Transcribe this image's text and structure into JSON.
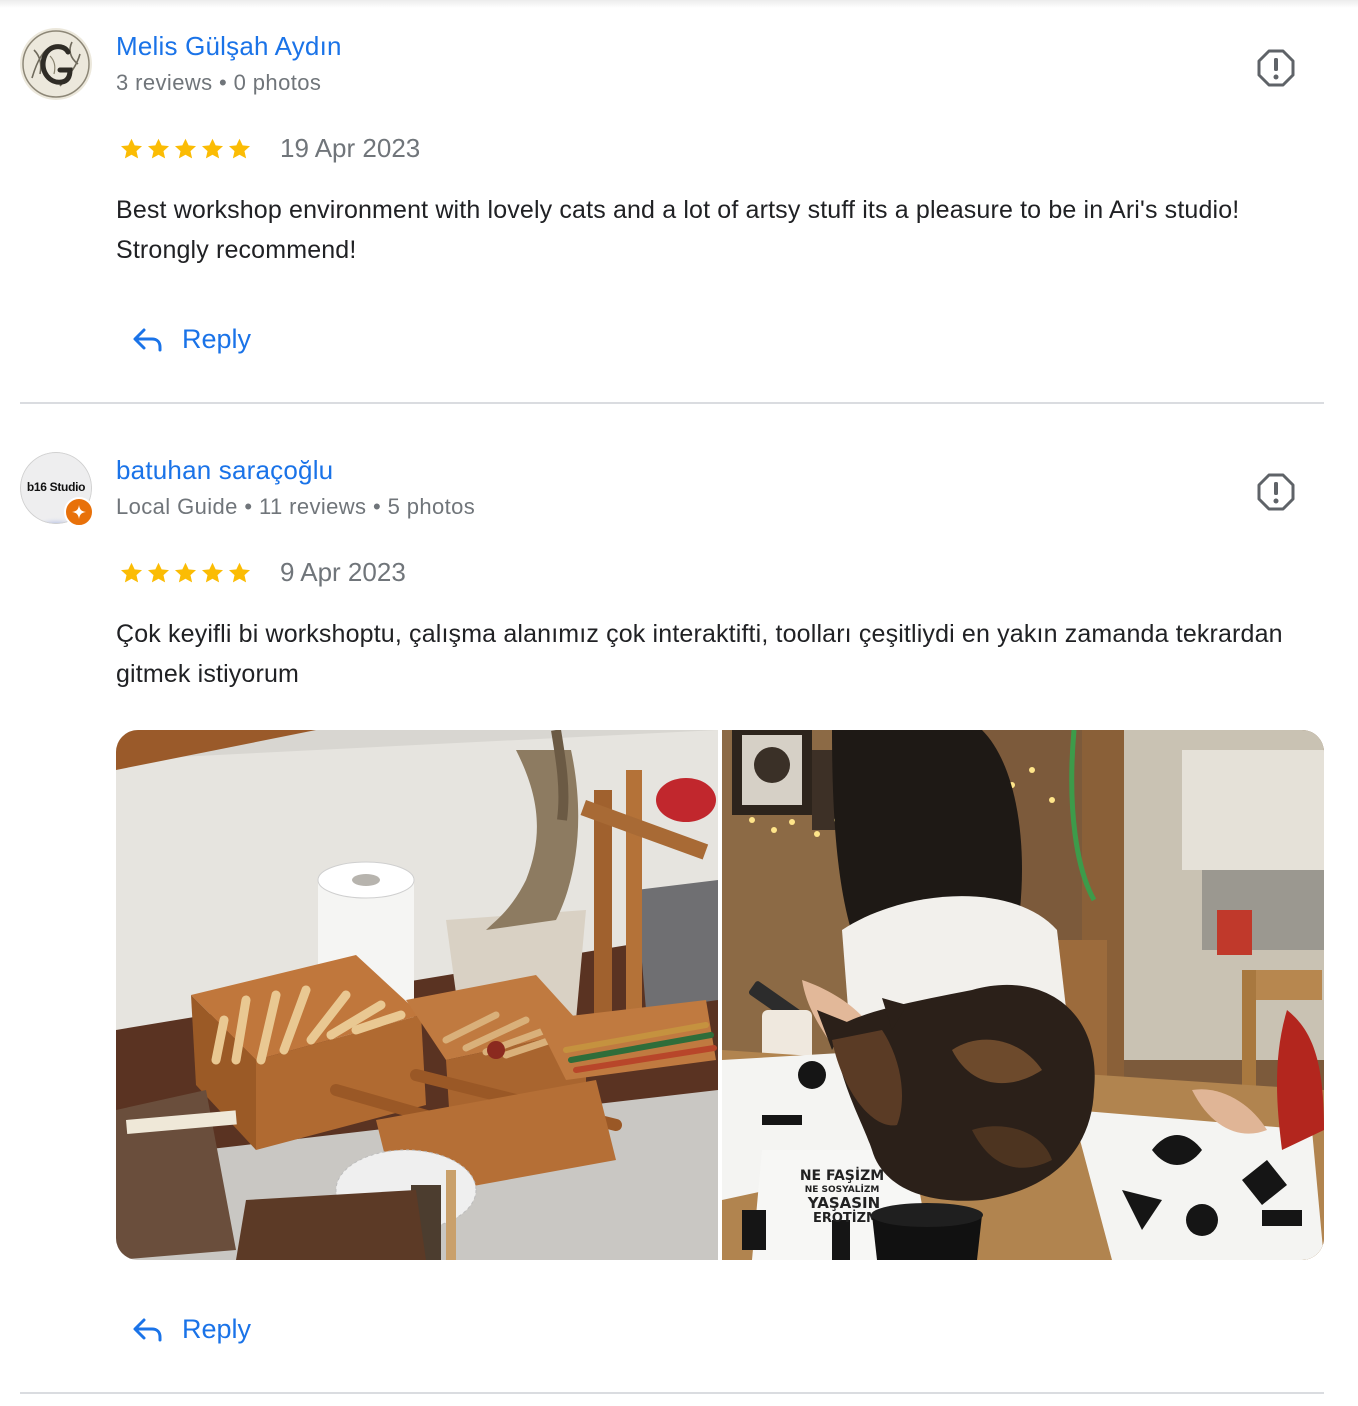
{
  "reviews": [
    {
      "author": "Melis Gülşah Aydın",
      "meta": "3 reviews • 0 photos",
      "rating": 5,
      "date": "19 Apr 2023",
      "text": "Best workshop environment with lovely cats and a lot of artsy stuff its a pleasure to be in Ari's studio! Strongly recommend!",
      "reply_label": "Reply",
      "avatar_icon": "engraved-letter-g-avatar"
    },
    {
      "author": "batuhan saraçoğlu",
      "meta": "Local Guide • 11 reviews • 5 photos",
      "rating": 5,
      "date": "9 Apr 2023",
      "text": "Çok keyifli bi workshoptu, çalışma alanımız çok interaktifti, toolları çeşitliydi en yakın zamanda tekrardan gitmek istiyorum",
      "reply_label": "Reply",
      "avatar_text": "b16 Studio",
      "avatar_icon": "local-guide-badge-icon",
      "photos": [
        "wooden-tool-box-photo",
        "cat-on-table-photo"
      ],
      "photo_text": {
        "poster_lines": [
          "NE FAŞİZM",
          "NE SOSYALİZM",
          "YAŞASIN",
          "EROTİZM"
        ]
      }
    }
  ],
  "colors": {
    "link": "#1a73e8",
    "star": "#fbbc04",
    "meta": "#70757a",
    "divider": "#dadce0",
    "badge": "#e8710a"
  }
}
